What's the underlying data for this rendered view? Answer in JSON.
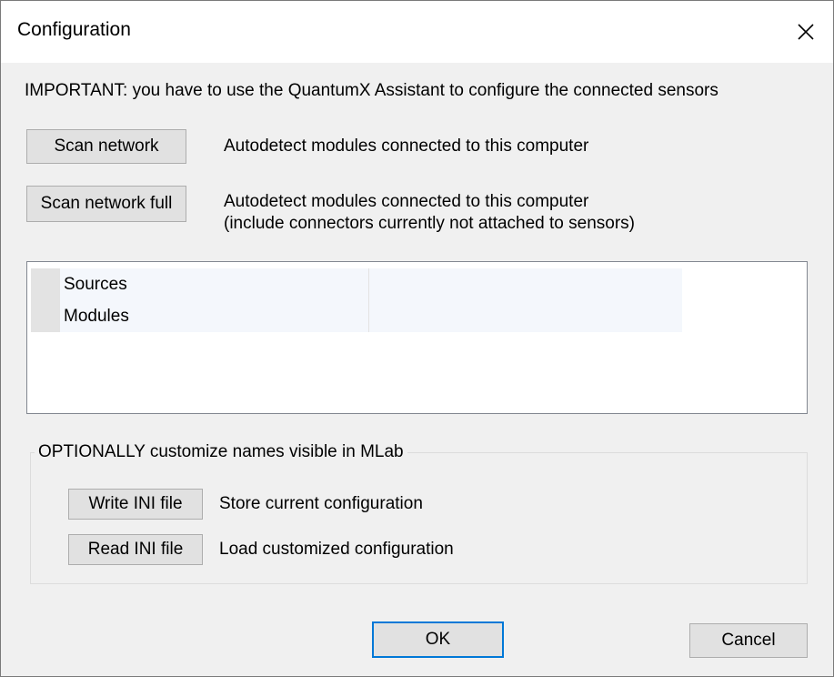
{
  "window": {
    "title": "Configuration",
    "close_icon": "close-icon"
  },
  "notice": "IMPORTANT: you have to use the QuantumX Assistant to configure the connected sensors",
  "scan": {
    "button_label": "Scan network",
    "description": "Autodetect modules connected to this computer"
  },
  "scan_full": {
    "button_label": "Scan network full",
    "description_line1": "Autodetect modules connected to this computer",
    "description_line2": "(include connectors currently not attached to sensors)"
  },
  "tree": {
    "rows": [
      {
        "name": "Sources",
        "value": ""
      },
      {
        "name": "Modules",
        "value": ""
      }
    ]
  },
  "optional_group": {
    "legend": "OPTIONALLY customize names visible in MLab",
    "write_button": "Write INI file",
    "write_description": "Store current configuration",
    "read_button": "Read INI file",
    "read_description": "Load customized configuration"
  },
  "footer": {
    "ok_label": "OK",
    "cancel_label": "Cancel"
  },
  "colors": {
    "button_face": "#e1e1e1",
    "button_border": "#adadad",
    "default_button_border": "#0078d7",
    "dialog_background": "#f0f0f0"
  }
}
